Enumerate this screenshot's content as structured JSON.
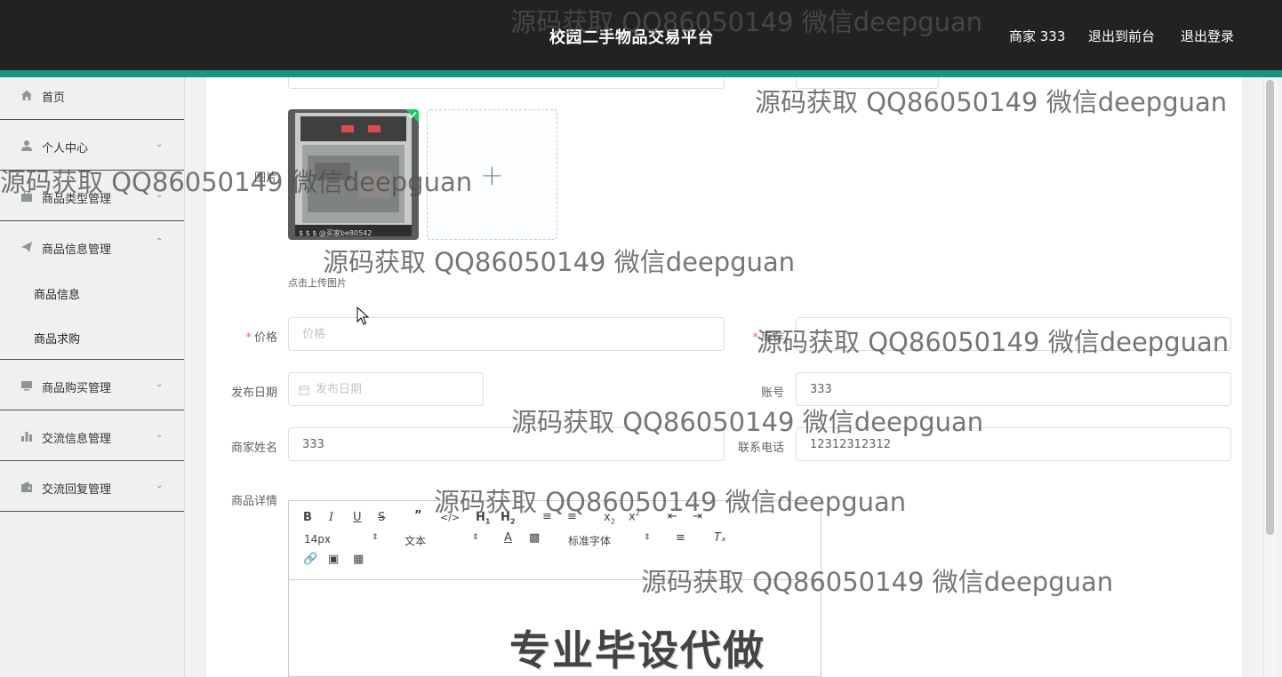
{
  "header": {
    "title": "校园二手物品交易平台",
    "nav": [
      "商家 333",
      "退出到前台",
      "退出登录"
    ]
  },
  "sidebar": {
    "items": [
      {
        "label": "首页",
        "icon": "home-icon"
      },
      {
        "label": "个人中心",
        "icon": "user-icon"
      },
      {
        "label": "商品类型管理",
        "icon": "briefcase-icon"
      },
      {
        "label": "商品信息管理",
        "icon": "paper-plane-icon"
      },
      {
        "label": "商品购买管理",
        "icon": "monitor-icon"
      },
      {
        "label": "交流信息管理",
        "icon": "bar-chart-icon"
      },
      {
        "label": "交流回复管理",
        "icon": "wallet-icon"
      }
    ],
    "sub_items": [
      "商品信息",
      "商品求购"
    ]
  },
  "form": {
    "image_label": "图片",
    "image_caption": "$ $ $ @买家be80542",
    "upload_tip": "点击上传图片",
    "price_label": "价格",
    "price_placeholder": "价格",
    "stock_label": "库存",
    "date_label": "发布日期",
    "date_placeholder": "发布日期",
    "account_label": "账号",
    "account_value": "333",
    "merchant_name_label": "商家姓名",
    "merchant_name_value": "333",
    "phone_label": "联系电话",
    "phone_value": "12312312312",
    "detail_label": "商品详情"
  },
  "editor": {
    "font_size": "14px",
    "paragraph": "文本",
    "font_family": "标准字体",
    "content": "专业毕设代做"
  },
  "watermark": "源码获取 QQ86050149 微信deepguan"
}
